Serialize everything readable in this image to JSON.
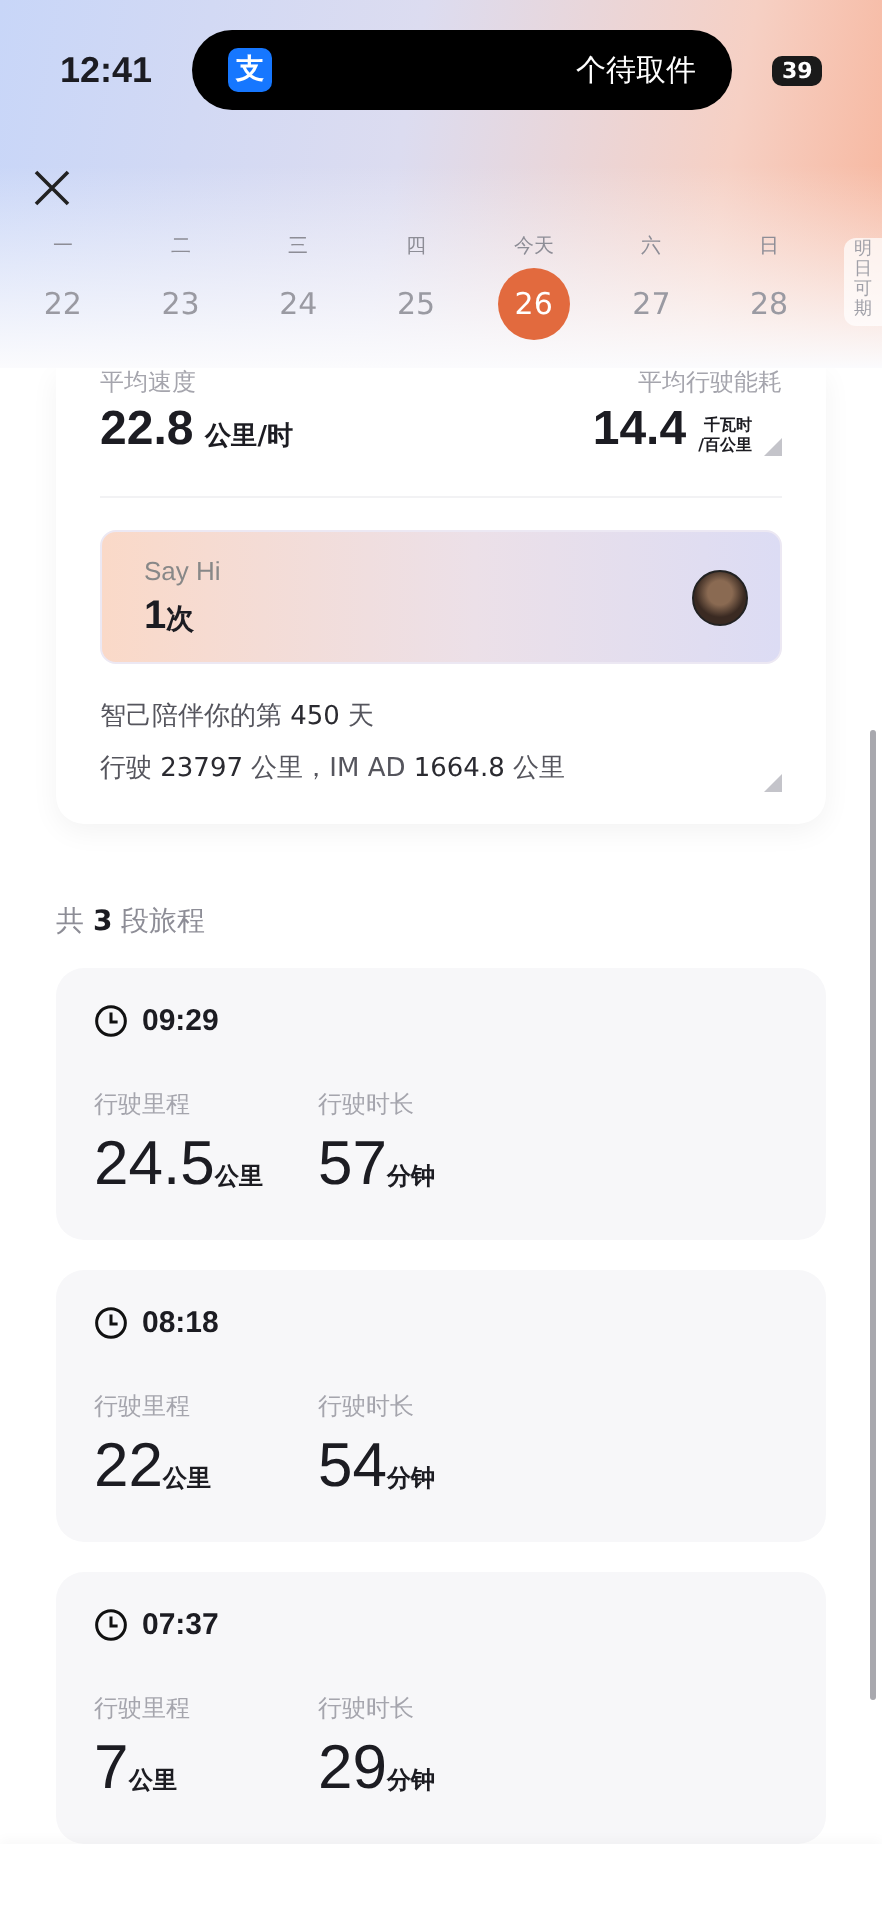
{
  "status_bar": {
    "time": "12:41",
    "island_app_glyph": "支",
    "island_text": "个待取件",
    "battery": "39"
  },
  "week": [
    {
      "weekday": "一",
      "date": "22",
      "selected": false
    },
    {
      "weekday": "二",
      "date": "23",
      "selected": false
    },
    {
      "weekday": "三",
      "date": "24",
      "selected": false
    },
    {
      "weekday": "四",
      "date": "25",
      "selected": false
    },
    {
      "weekday": "今天",
      "date": "26",
      "selected": true
    },
    {
      "weekday": "六",
      "date": "27",
      "selected": false
    },
    {
      "weekday": "日",
      "date": "28",
      "selected": false
    }
  ],
  "side_tab": "明日可期",
  "stats": {
    "left_label": "平均速度",
    "left_value": "22.8",
    "left_unit": "公里/时",
    "right_label": "平均行驶能耗",
    "right_value": "14.4",
    "right_unit_top": "千瓦时",
    "right_unit_bottom": "/百公里"
  },
  "say_hi": {
    "title": "Say Hi",
    "count": "1",
    "unit": "次"
  },
  "summary": [
    "智己陪伴你的第 **450** 天",
    "行驶 **23797** 公里，IM AD **1664.8** 公里"
  ],
  "trips_heading": "共 **3** 段旅程",
  "trips": [
    {
      "time": "09:29",
      "distance_label": "行驶里程",
      "distance": "24.5",
      "distance_unit": "公里",
      "duration_label": "行驶时长",
      "duration": "57",
      "duration_unit": "分钟"
    },
    {
      "time": "08:18",
      "distance_label": "行驶里程",
      "distance": "22",
      "distance_unit": "公里",
      "duration_label": "行驶时长",
      "duration": "54",
      "duration_unit": "分钟"
    },
    {
      "time": "07:37",
      "distance_label": "行驶里程",
      "distance": "7",
      "distance_unit": "公里",
      "duration_label": "行驶时长",
      "duration": "29",
      "duration_unit": "分钟"
    }
  ]
}
